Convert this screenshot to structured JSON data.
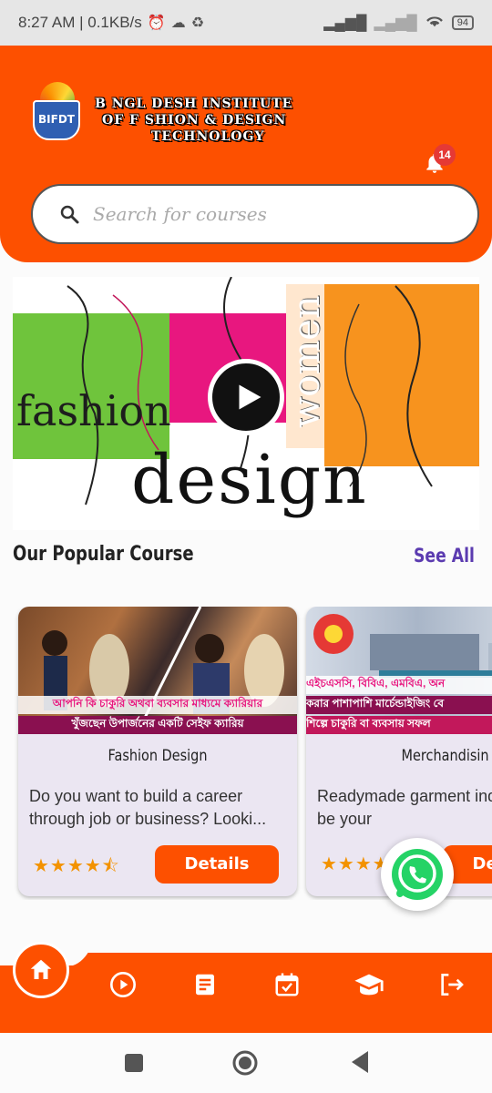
{
  "status_bar": {
    "time_speed": "8:27 AM | 0.1KB/s",
    "battery": "94"
  },
  "header": {
    "logo_abbr": "BIFDT",
    "brand_line1": "B NGL DESH INSTITUTE",
    "brand_line2": "OF F SHION & DESIGN",
    "brand_line3": "TECHNOLOGY",
    "notification_count": "14"
  },
  "search": {
    "placeholder": "Search for courses"
  },
  "banner": {
    "word_fashion": "fashion",
    "word_women": "women",
    "word_design": "design"
  },
  "popular": {
    "title": "Our Popular Course",
    "see_all": "See All"
  },
  "courses": [
    {
      "image_caption_1": "আপনি কি চাকুরি অথবা ব্যবসার মাধ্যমে ক্যারিয়ার",
      "image_caption_2": "খুঁজছেন উপার্জনের একটি সেইফ ক্যারিয়",
      "title": "Fashion Design",
      "description": "Do you want to build a career through job or business? Looki...",
      "rating_stars": "★★★★⯪",
      "rating": 4.5,
      "button": "Details"
    },
    {
      "image_caption_1": "এইচএসসি, বিবিএ, এমবিএ, অন",
      "image_caption_2": "করার পাশাপাশি মার্চেন্ডাইজিং বে",
      "image_caption_3": "শিল্পে চাকুরি বা ব্যবসায় সফল",
      "title": "Merchandisin",
      "description": "Readymade garment industry may be your",
      "rating_stars": "★★★★",
      "button": "Details"
    }
  ],
  "colors": {
    "primary": "#fd5000",
    "accent": "#5b3bb0",
    "star": "#f39200",
    "whatsapp": "#25d366"
  },
  "nav": {
    "items": [
      "home-icon",
      "play-circle-icon",
      "document-icon",
      "calendar-check-icon",
      "graduation-cap-icon",
      "logout-icon"
    ]
  }
}
